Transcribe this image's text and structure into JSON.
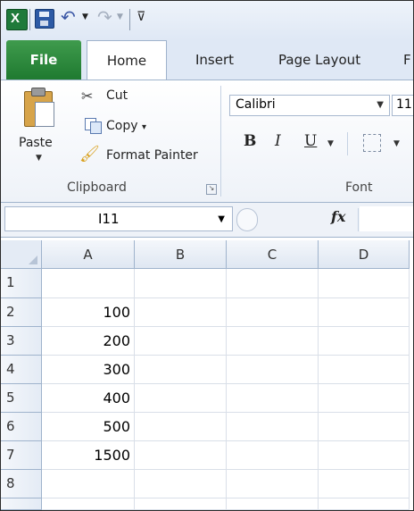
{
  "quick_access": {
    "app_icon": "excel-icon",
    "save_icon": "save-icon",
    "undo_icon": "undo-icon",
    "redo_icon": "redo-icon",
    "customize_icon": "customize-qat-icon"
  },
  "tabs": [
    {
      "label": "File"
    },
    {
      "label": "Home"
    },
    {
      "label": "Insert"
    },
    {
      "label": "Page Layout"
    },
    {
      "label": "F"
    }
  ],
  "clipboard": {
    "paste_label": "Paste",
    "cut_label": "Cut",
    "copy_label": "Copy",
    "copy_dd": "▾",
    "format_painter_label": "Format Painter",
    "group_label": "Clipboard"
  },
  "font": {
    "name": "Calibri",
    "size": "11",
    "bold": "B",
    "italic": "I",
    "underline": "U",
    "group_label": "Font"
  },
  "formula_bar": {
    "name_box": "I11",
    "fx": "fx",
    "formula": ""
  },
  "grid": {
    "columns": [
      "A",
      "B",
      "C",
      "D"
    ],
    "rows": [
      "1",
      "2",
      "3",
      "4",
      "5",
      "6",
      "7",
      "8"
    ],
    "a_values": [
      "",
      "100",
      "200",
      "300",
      "400",
      "500",
      "1500",
      ""
    ]
  },
  "colors": {
    "file_tab": "#1f7a30",
    "ribbon_bg": "#eef2f8",
    "header_bg": "#e4ebf5"
  }
}
